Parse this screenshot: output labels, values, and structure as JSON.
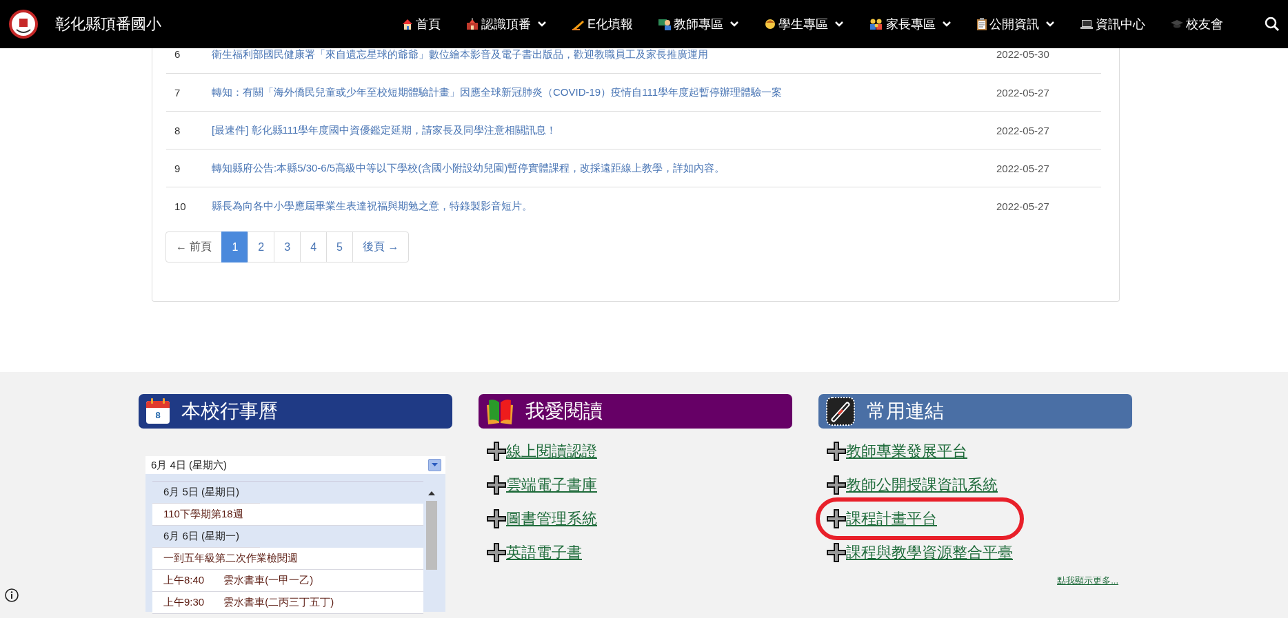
{
  "navbar": {
    "site_title": "彰化縣頂番國小",
    "items": [
      {
        "label": "首頁",
        "has_menu": false
      },
      {
        "label": "認識頂番",
        "has_menu": true
      },
      {
        "label": "E化填報",
        "has_menu": false
      },
      {
        "label": "教師專區",
        "has_menu": true
      },
      {
        "label": "學生專區",
        "has_menu": true
      },
      {
        "label": "家長專區",
        "has_menu": true
      },
      {
        "label": "公開資訊",
        "has_menu": true
      },
      {
        "label": "資訊中心",
        "has_menu": false
      },
      {
        "label": "校友會",
        "has_menu": false
      }
    ]
  },
  "news_table": {
    "rows": [
      {
        "number": "6",
        "title": "衛生福利部國民健康署「來自遺忘星球的爺爺」數位繪本影音及電子書出版品，歡迎教職員工及家長推廣運用",
        "date": "2022-05-30"
      },
      {
        "number": "7",
        "title": "轉知：有關「海外僑民兒童或少年至校短期體驗計畫」因應全球新冠肺炎（COVID-19）疫情自111學年度起暫停辦理體驗一案",
        "date": "2022-05-27"
      },
      {
        "number": "8",
        "title": "[最速件] 彰化縣111學年度國中資優鑑定延期，請家長及同學注意相關訊息！",
        "date": "2022-05-27"
      },
      {
        "number": "9",
        "title": "轉知縣府公告:本縣5/30-6/5高級中等以下學校(含國小附設幼兒園)暫停實體課程，改採遠距線上教學，詳如內容。",
        "date": "2022-05-27"
      },
      {
        "number": "10",
        "title": "縣長為向各中小學應屆畢業生表達祝福與期勉之意，特錄製影音短片。",
        "date": "2022-05-27"
      }
    ],
    "pagination": [
      {
        "label": "← 前頁",
        "selected": false
      },
      {
        "label": "1",
        "selected": true
      },
      {
        "label": "2",
        "selected": false
      },
      {
        "label": "3",
        "selected": false
      },
      {
        "label": "4",
        "selected": false
      },
      {
        "label": "5",
        "selected": false
      },
      {
        "label": "後頁 →",
        "selected": false
      }
    ]
  },
  "footer": {
    "panels": [
      {
        "kind": "calendar",
        "title": "本校行事曆",
        "icon_number": "8",
        "color": "#1f3a85",
        "select_value": "6月 4日 (星期六)",
        "entries": [
          {
            "kind": "date",
            "text": "6月 5日 (星期日)"
          },
          {
            "kind": "event",
            "text": "110下學期第18週"
          },
          {
            "kind": "date",
            "text": "6月 6日 (星期一)"
          },
          {
            "kind": "event",
            "text": "一到五年級第二次作業檢閱週"
          },
          {
            "kind": "timed",
            "time": "上午8:40",
            "text": "雲水書車(一甲一乙)"
          },
          {
            "kind": "timed",
            "time": "上午9:30",
            "text": "雲水書車(二丙三丁五丁)"
          }
        ]
      },
      {
        "kind": "links",
        "title": "我愛閱讀",
        "color": "#660066",
        "links": [
          {
            "label": "線上閱讀認證",
            "highlighted": false
          },
          {
            "label": "雲端電子書庫",
            "highlighted": false
          },
          {
            "label": "圖書管理系統",
            "highlighted": false
          },
          {
            "label": "英語電子書",
            "highlighted": false
          }
        ]
      },
      {
        "kind": "links",
        "title": "常用連結",
        "color": "#4a6fa5",
        "links": [
          {
            "label": "教師專業發展平台",
            "highlighted": false
          },
          {
            "label": "教師公開授課資訊系統",
            "highlighted": false
          },
          {
            "label": "課程計畫平台",
            "highlighted": true
          },
          {
            "label": "課程與教學資源整合平臺",
            "highlighted": false
          }
        ],
        "more_link": "點我顯示更多..."
      }
    ]
  }
}
